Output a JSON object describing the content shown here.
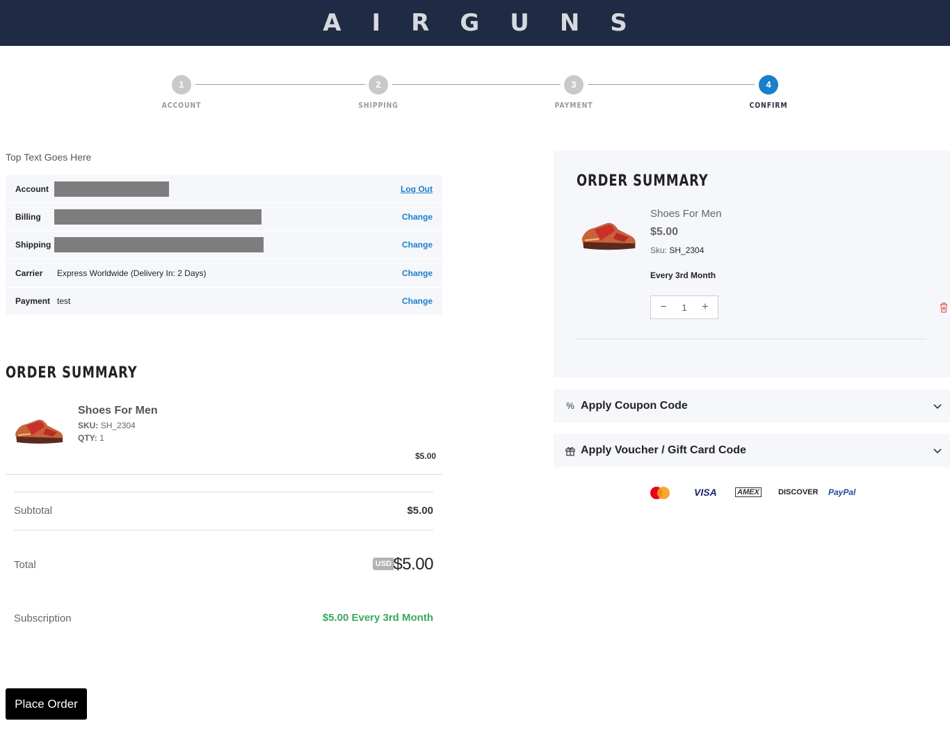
{
  "header": {
    "logo": "AIRGUNS"
  },
  "stepper": {
    "steps": [
      {
        "number": "1",
        "label": "ACCOUNT"
      },
      {
        "number": "2",
        "label": "SHIPPING"
      },
      {
        "number": "3",
        "label": "PAYMENT"
      },
      {
        "number": "4",
        "label": "CONFIRM"
      }
    ],
    "active_step": 4
  },
  "checkout": {
    "top_text": "Top Text Goes Here",
    "rows": [
      {
        "label": "Account",
        "value": "",
        "redacted": true,
        "action": "Log Out"
      },
      {
        "label": "Billing",
        "value": "",
        "redacted": true,
        "action": "Change"
      },
      {
        "label": "Shipping",
        "value": "",
        "redacted": true,
        "action": "Change"
      },
      {
        "label": "Carrier",
        "value": "Express Worldwide (Delivery In: 2 Days)",
        "redacted": false,
        "action": "Change"
      },
      {
        "label": "Payment",
        "value": "test",
        "redacted": false,
        "action": "Change"
      }
    ]
  },
  "left_summary": {
    "title": "ORDER SUMMARY",
    "item": {
      "name": "Shoes For Men",
      "sku_label": "SKU:",
      "sku": "SH_2304",
      "qty_label": "QTY:",
      "qty": "1",
      "price": "$5.00"
    },
    "subtotal_label": "Subtotal",
    "subtotal_value": "$5.00",
    "total_label": "Total",
    "currency_badge": "USD",
    "total_value": "$5.00",
    "subscription_label": "Subscription",
    "subscription_value": "$5.00 Every 3rd Month",
    "place_order": "Place Order"
  },
  "right_summary": {
    "title": "ORDER SUMMARY",
    "item": {
      "name": "Shoes For Men",
      "price": "$5.00",
      "sku_label": "Sku:",
      "sku": "SH_2304",
      "frequency": "Every 3rd Month",
      "qty": "1"
    },
    "coupon_label": "Apply Coupon Code",
    "voucher_label": "Apply Voucher / Gift Card Code"
  },
  "payment_logos": [
    "VISA",
    "AMEX",
    "DISCOVER",
    "PayPal"
  ],
  "colors": {
    "header_bg": "#1f2b44",
    "accent": "#1a7fc9",
    "subscription": "#3aa760"
  }
}
